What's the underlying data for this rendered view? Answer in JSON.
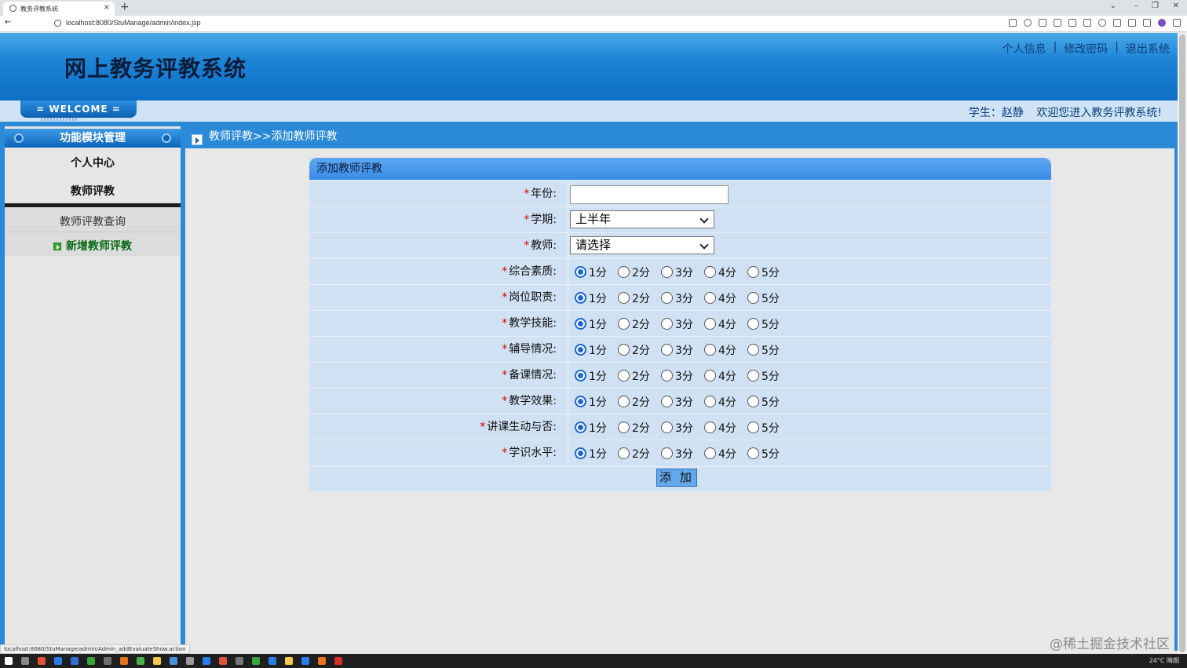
{
  "browser": {
    "tab_title": "教务评教系统",
    "tab_close": "×",
    "new_tab": "+",
    "back_label": "←",
    "url": "localhost:8080/StuManage/admin/index.jsp",
    "status_url": "localhost:8080/StuManage/admin/Admin_addEvaluateShow.action"
  },
  "header": {
    "title": "网上教务评教系统",
    "links": [
      "个人信息",
      "修改密码",
      "退出系统"
    ],
    "separator": "|",
    "welcome_badge": "= WELCOME =",
    "user_label": "学生：赵静",
    "welcome_message": "欢迎您进入教务评教系统!"
  },
  "sidebar": {
    "title": "功能模块管理",
    "items": [
      "个人中心",
      "教师评教"
    ],
    "sub_items": [
      "教师评教查询",
      "新增教师评教"
    ]
  },
  "breadcrumb": "教师评教>>添加教师评教",
  "form": {
    "title": "添加教师评教",
    "required_mark": "*",
    "year": {
      "label": "年份:",
      "value": ""
    },
    "semester": {
      "label": "学期:",
      "value": "上半年"
    },
    "teacher": {
      "label": "教师:",
      "value": "请选择"
    },
    "score_options": [
      "1分",
      "2分",
      "3分",
      "4分",
      "5分"
    ],
    "criteria": [
      {
        "label": "综合素质:",
        "selected": "1分"
      },
      {
        "label": "岗位职责:",
        "selected": "1分"
      },
      {
        "label": "教学技能:",
        "selected": "1分"
      },
      {
        "label": "辅导情况:",
        "selected": "1分"
      },
      {
        "label": "备课情况:",
        "selected": "1分"
      },
      {
        "label": "教学效果:",
        "selected": "1分"
      },
      {
        "label": "讲课生动与否:",
        "selected": "1分"
      },
      {
        "label": "学识水平:",
        "selected": "1分"
      }
    ],
    "submit_label": "添 加"
  },
  "watermark": "@稀土掘金技术社区",
  "taskbar": {
    "weather": "24°C 晴朗"
  },
  "colors": {
    "header_blue": "#1d84d6",
    "frame_blue": "#2a8ad8",
    "form_bg": "#cfe1f3",
    "required": "#dd0000"
  }
}
